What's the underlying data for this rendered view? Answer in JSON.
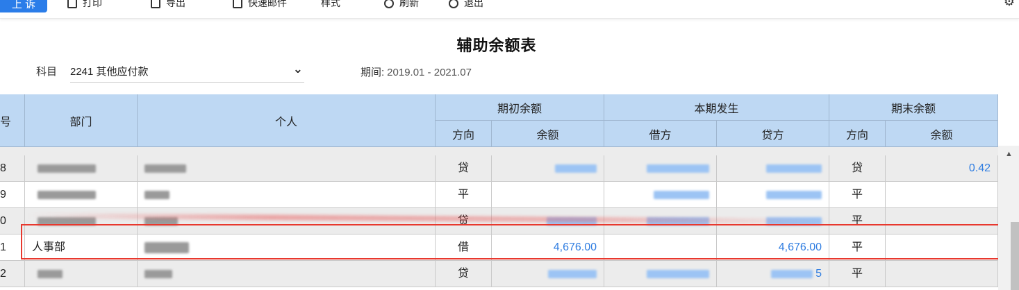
{
  "toolbar": {
    "primary_label": "上 诉",
    "items": [
      "打印",
      "导出",
      "快速邮件",
      "样式",
      "刷新",
      "退出"
    ]
  },
  "report": {
    "title": "辅助余额表",
    "subject_label": "科目",
    "subject_value": "2241 其他应付款",
    "period_label": "期间:",
    "period_value": "2019.01 - 2021.07"
  },
  "table": {
    "headers": {
      "seq": "号",
      "department": "部门",
      "person": "个人",
      "opening": "期初余额",
      "current": "本期发生",
      "closing": "期末余额",
      "direction": "方向",
      "balance": "余额",
      "debit": "借方",
      "credit": "贷方"
    },
    "rows": [
      {
        "seq": "8",
        "department": "",
        "person": "",
        "open_dir": "贷",
        "open_bal": "",
        "debit": "",
        "credit": "",
        "close_dir": "贷",
        "close_bal": "0.42"
      },
      {
        "seq": "9",
        "department": "",
        "person": "",
        "open_dir": "平",
        "open_bal": "",
        "debit": "",
        "credit": "",
        "close_dir": "平",
        "close_bal": ""
      },
      {
        "seq": "0",
        "department": "",
        "person": "",
        "open_dir": "贷",
        "open_bal": "",
        "debit": "",
        "credit": "",
        "close_dir": "平",
        "close_bal": ""
      },
      {
        "seq": "1",
        "department": "人事部",
        "person": "",
        "open_dir": "借",
        "open_bal": "4,676.00",
        "debit": "",
        "credit": "4,676.00",
        "close_dir": "平",
        "close_bal": ""
      },
      {
        "seq": "2",
        "department": "",
        "person": "",
        "open_dir": "贷",
        "open_bal": "",
        "debit": "",
        "credit": "5",
        "close_dir": "平",
        "close_bal": ""
      }
    ]
  },
  "colors": {
    "header_bg": "#bed8f3",
    "amount_text": "#2f7de1",
    "highlight_border": "#e8382e",
    "primary_button": "#2b7de9"
  }
}
